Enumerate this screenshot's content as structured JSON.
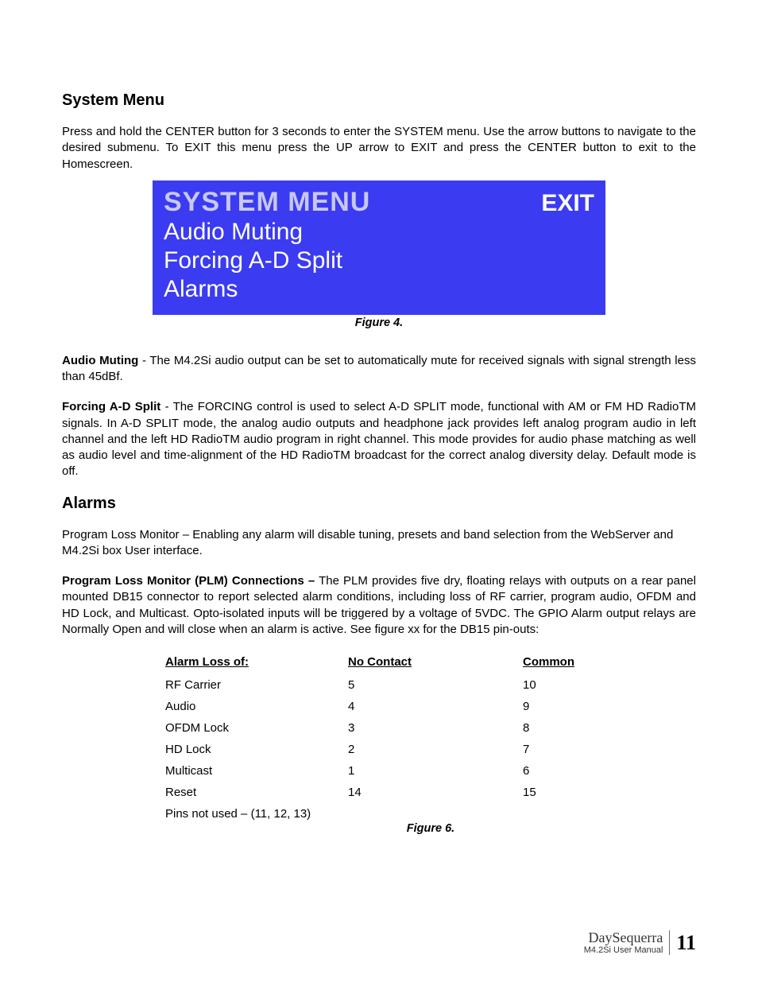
{
  "headings": {
    "system_menu": "System Menu",
    "alarms": "Alarms"
  },
  "intro": "Press and hold the CENTER button for 3 seconds to enter the SYSTEM menu.  Use the arrow buttons to navigate to the desired submenu.  To EXIT this menu press the UP arrow to EXIT and press the CENTER button to exit to the Homescreen.",
  "screen": {
    "title": "SYSTEM MENU",
    "exit": "EXIT",
    "line1": "Audio Muting",
    "line2": "Forcing A-D Split",
    "line3": "Alarms"
  },
  "captions": {
    "fig4": "Figure 4.",
    "fig6": "Figure 6."
  },
  "audio_muting": {
    "label": "Audio Muting",
    "text": " - The M4.2Si audio output can be set to automatically mute for received signals with signal strength less than 45dBf."
  },
  "forcing": {
    "label": "Forcing A-D Split",
    "text": " - The FORCING control is used to select A-D SPLIT mode, functional with AM or FM HD RadioTM signals.  In A-D SPLIT mode, the analog audio outputs and headphone jack provides left analog program audio in left channel and the left HD RadioTM audio program in right channel.  This mode provides for audio phase matching as well as audio level and time-alignment of the HD RadioTM broadcast for the correct analog diversity delay.  Default mode is off."
  },
  "plm": {
    "label": "Program Loss Monitor –",
    "text": " Enabling any alarm will disable tuning, presets and band selection from the WebServer and M4.2Si box User interface."
  },
  "plm_conn": {
    "label": "Program Loss Monitor (PLM) Connections –",
    "text": " The PLM provides five dry, floating relays with outputs on a rear panel mounted DB15 connector to report selected alarm conditions, including loss of RF carrier, program audio, OFDM and HD Lock, and Multicast. Opto-isolated inputs will be triggered by a voltage of 5VDC. The GPIO Alarm output relays are Normally Open and will close when an alarm is active.  See figure xx for the DB15 pin-outs:"
  },
  "table": {
    "headers": {
      "c1": "Alarm Loss of:",
      "c2": "No Contact",
      "c3": "Common"
    },
    "rows": [
      {
        "c1": "RF Carrier",
        "c2": "5",
        "c3": "10"
      },
      {
        "c1": "Audio",
        "c2": "4",
        "c3": "9"
      },
      {
        "c1": "OFDM Lock",
        "c2": "3",
        "c3": "8"
      },
      {
        "c1": "HD Lock",
        "c2": "2",
        "c3": "7"
      },
      {
        "c1": "Multicast",
        "c2": "1",
        "c3": "6"
      },
      {
        "c1": "Reset",
        "c2": "14",
        "c3": "15"
      }
    ],
    "note": "Pins not used – (11, 12, 13)"
  },
  "footer": {
    "brand": "DaySequerra",
    "manual": "M4.2Si User Manual",
    "page": "11"
  }
}
